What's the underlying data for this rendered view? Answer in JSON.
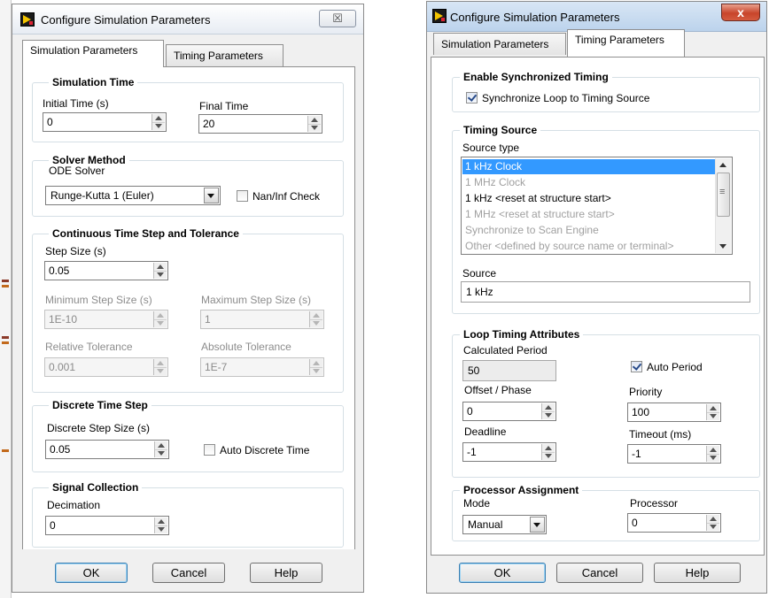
{
  "left_dialog": {
    "title": "Configure Simulation Parameters",
    "close_glyph": "☒",
    "tabs": [
      "Simulation Parameters",
      "Timing Parameters"
    ],
    "active_tab": "Simulation Parameters",
    "simulation_time": {
      "title": "Simulation Time",
      "initial_label": "Initial Time (s)",
      "initial_value": "0",
      "final_label": "Final Time",
      "final_value": "20"
    },
    "solver_method": {
      "title": "Solver Method",
      "ode_label": "ODE Solver",
      "ode_value": "Runge-Kutta 1 (Euler)",
      "naninf_label": "Nan/Inf Check",
      "naninf_checked": false
    },
    "continuous": {
      "title": "Continuous Time Step and Tolerance",
      "step_label": "Step Size (s)",
      "step_value": "0.05",
      "min_label": "Minimum Step Size (s)",
      "min_value": "1E-10",
      "max_label": "Maximum Step Size (s)",
      "max_value": "1",
      "rel_label": "Relative Tolerance",
      "rel_value": "0.001",
      "abs_label": "Absolute Tolerance",
      "abs_value": "1E-7"
    },
    "discrete": {
      "title": "Discrete Time Step",
      "size_label": "Discrete Step Size (s)",
      "size_value": "0.05",
      "auto_label": "Auto Discrete Time",
      "auto_checked": false
    },
    "signal": {
      "title": "Signal Collection",
      "decimation_label": "Decimation",
      "decimation_value": "0"
    },
    "buttons": {
      "ok": "OK",
      "cancel": "Cancel",
      "help": "Help"
    }
  },
  "right_dialog": {
    "title": "Configure Simulation Parameters",
    "close_glyph": "x",
    "tabs": [
      "Simulation Parameters",
      "Timing Parameters"
    ],
    "active_tab": "Timing Parameters",
    "sync": {
      "title": "Enable Synchronized Timing",
      "checkbox_label": "Synchronize Loop to Timing Source",
      "checked": true
    },
    "timing_source": {
      "title": "Timing Source",
      "source_type_label": "Source type",
      "items": [
        {
          "label": "1 kHz Clock",
          "state": "selected"
        },
        {
          "label": "1 MHz Clock",
          "state": "disabled"
        },
        {
          "label": "1 kHz <reset at structure start>",
          "state": "normal"
        },
        {
          "label": "1 MHz <reset at structure start>",
          "state": "disabled"
        },
        {
          "label": "Synchronize to Scan Engine",
          "state": "disabled"
        },
        {
          "label": "Other <defined by source name or terminal>",
          "state": "disabled"
        }
      ],
      "source_label": "Source",
      "source_value": "1 kHz"
    },
    "loop_timing": {
      "title": "Loop Timing Attributes",
      "calc_label": "Calculated Period",
      "calc_value": "50",
      "auto_label": "Auto Period",
      "auto_checked": true,
      "offset_label": "Offset / Phase",
      "offset_value": "0",
      "priority_label": "Priority",
      "priority_value": "100",
      "deadline_label": "Deadline",
      "deadline_value": "-1",
      "timeout_label": "Timeout (ms)",
      "timeout_value": "-1"
    },
    "processor": {
      "title": "Processor Assignment",
      "mode_label": "Mode",
      "mode_value": "Manual",
      "processor_label": "Processor",
      "processor_value": "0"
    },
    "buttons": {
      "ok": "OK",
      "cancel": "Cancel",
      "help": "Help"
    }
  }
}
